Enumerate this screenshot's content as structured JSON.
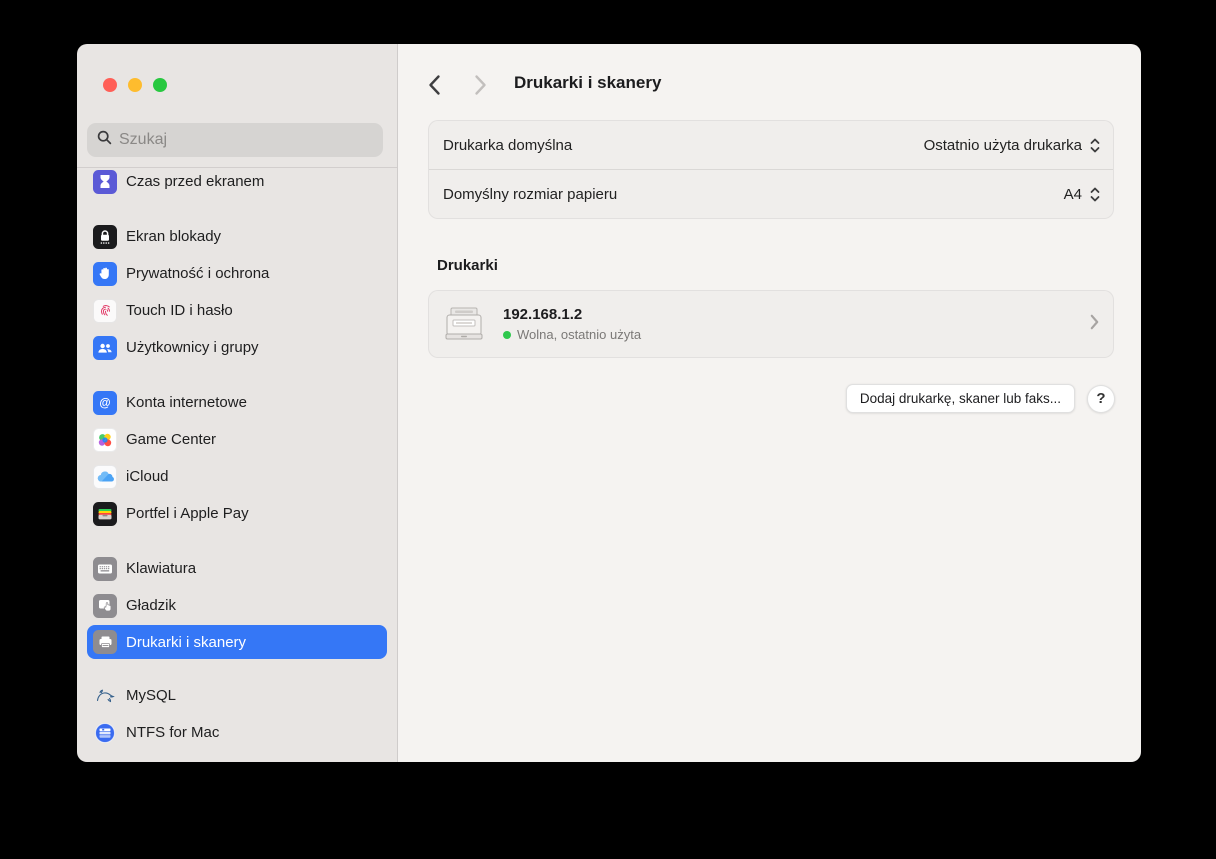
{
  "colors": {
    "accent": "#3577f6",
    "status-free": "#2fc84d",
    "traffic-red": "#ff5f57",
    "traffic-yellow": "#febc2e",
    "traffic-green": "#28c840"
  },
  "sidebar": {
    "search": {
      "placeholder": "Szukaj"
    },
    "items": [
      {
        "label": "Czas przed ekranem",
        "icon": "hourglass-icon"
      },
      {
        "label": "Ekran blokady",
        "icon": "lock-icon"
      },
      {
        "label": "Prywatność i ochrona",
        "icon": "hand-icon"
      },
      {
        "label": "Touch ID i hasło",
        "icon": "fingerprint-icon"
      },
      {
        "label": "Użytkownicy i grupy",
        "icon": "users-icon"
      },
      {
        "label": "Konta internetowe",
        "icon": "at-icon"
      },
      {
        "label": "Game Center",
        "icon": "game-center-icon"
      },
      {
        "label": "iCloud",
        "icon": "cloud-icon"
      },
      {
        "label": "Portfel i Apple Pay",
        "icon": "wallet-icon"
      },
      {
        "label": "Klawiatura",
        "icon": "keyboard-icon"
      },
      {
        "label": "Gładzik",
        "icon": "trackpad-icon"
      },
      {
        "label": "Drukarki i skanery",
        "icon": "printer-icon",
        "selected": true
      },
      {
        "label": "MySQL",
        "icon": "dolphin-icon"
      },
      {
        "label": "NTFS for Mac",
        "icon": "disk-icon"
      }
    ]
  },
  "header": {
    "title": "Drukarki i skanery"
  },
  "settings": {
    "rows": [
      {
        "label": "Drukarka domyślna",
        "value": "Ostatnio użyta drukarka"
      },
      {
        "label": "Domyślny rozmiar papieru",
        "value": "A4"
      }
    ]
  },
  "printers": {
    "section_title": "Drukarki",
    "items": [
      {
        "name": "192.168.1.2",
        "status": "Wolna, ostatnio użyta"
      }
    ]
  },
  "actions": {
    "add_button": "Dodaj drukarkę, skaner lub faks...",
    "help_button": "?"
  }
}
